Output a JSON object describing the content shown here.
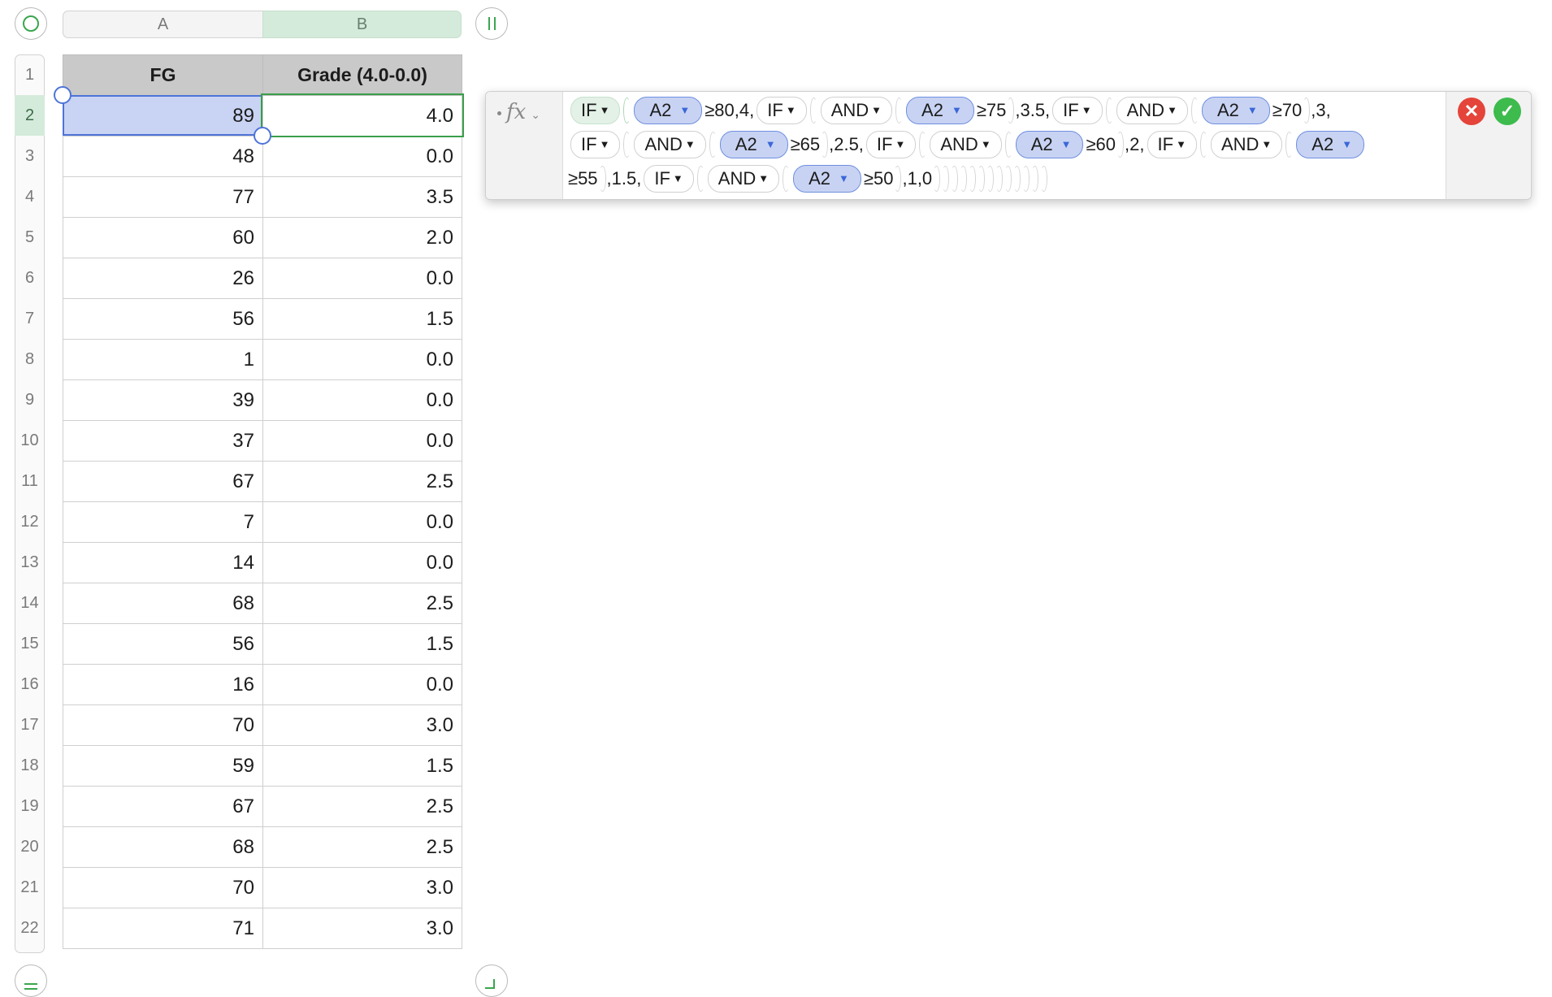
{
  "columns": [
    "A",
    "B"
  ],
  "rows": [
    "1",
    "2",
    "3",
    "4",
    "5",
    "6",
    "7",
    "8",
    "9",
    "10",
    "11",
    "12",
    "13",
    "14",
    "15",
    "16",
    "17",
    "18",
    "19",
    "20",
    "21",
    "22"
  ],
  "header": {
    "fg": "FG",
    "grade": "Grade (4.0-0.0)"
  },
  "data": [
    [
      "89",
      "4.0"
    ],
    [
      "48",
      "0.0"
    ],
    [
      "77",
      "3.5"
    ],
    [
      "60",
      "2.0"
    ],
    [
      "26",
      "0.0"
    ],
    [
      "56",
      "1.5"
    ],
    [
      "1",
      "0.0"
    ],
    [
      "39",
      "0.0"
    ],
    [
      "37",
      "0.0"
    ],
    [
      "67",
      "2.5"
    ],
    [
      "7",
      "0.0"
    ],
    [
      "14",
      "0.0"
    ],
    [
      "68",
      "2.5"
    ],
    [
      "56",
      "1.5"
    ],
    [
      "16",
      "0.0"
    ],
    [
      "70",
      "3.0"
    ],
    [
      "59",
      "1.5"
    ],
    [
      "67",
      "2.5"
    ],
    [
      "68",
      "2.5"
    ],
    [
      "70",
      "3.0"
    ],
    [
      "71",
      "3.0"
    ]
  ],
  "formula": {
    "fx_symbol": "fx",
    "cancel_icon": "✕",
    "accept_icon": "✓",
    "fn_if": "IF",
    "fn_and": "AND",
    "ref": "A2",
    "dropdown_glyph": "▼",
    "line1": {
      "t1": "≥80,4,",
      "t2": "≥75",
      "t3": ",3.5,",
      "t4": "≥70",
      "t5": ",3,"
    },
    "line2": {
      "t1": "≥65",
      "t2": ",2.5,",
      "t3": "≥60",
      "t4": ",2,"
    },
    "line3": {
      "t1": "≥55",
      "t2": ",1.5,",
      "t3": "≥50",
      "t4": ",1,0"
    }
  },
  "colors": {
    "selection": "#c9d3f4",
    "header_fill": "#c9c9c9",
    "active_border": "#3a9e4c",
    "ref_token": "#c8d3f3"
  }
}
